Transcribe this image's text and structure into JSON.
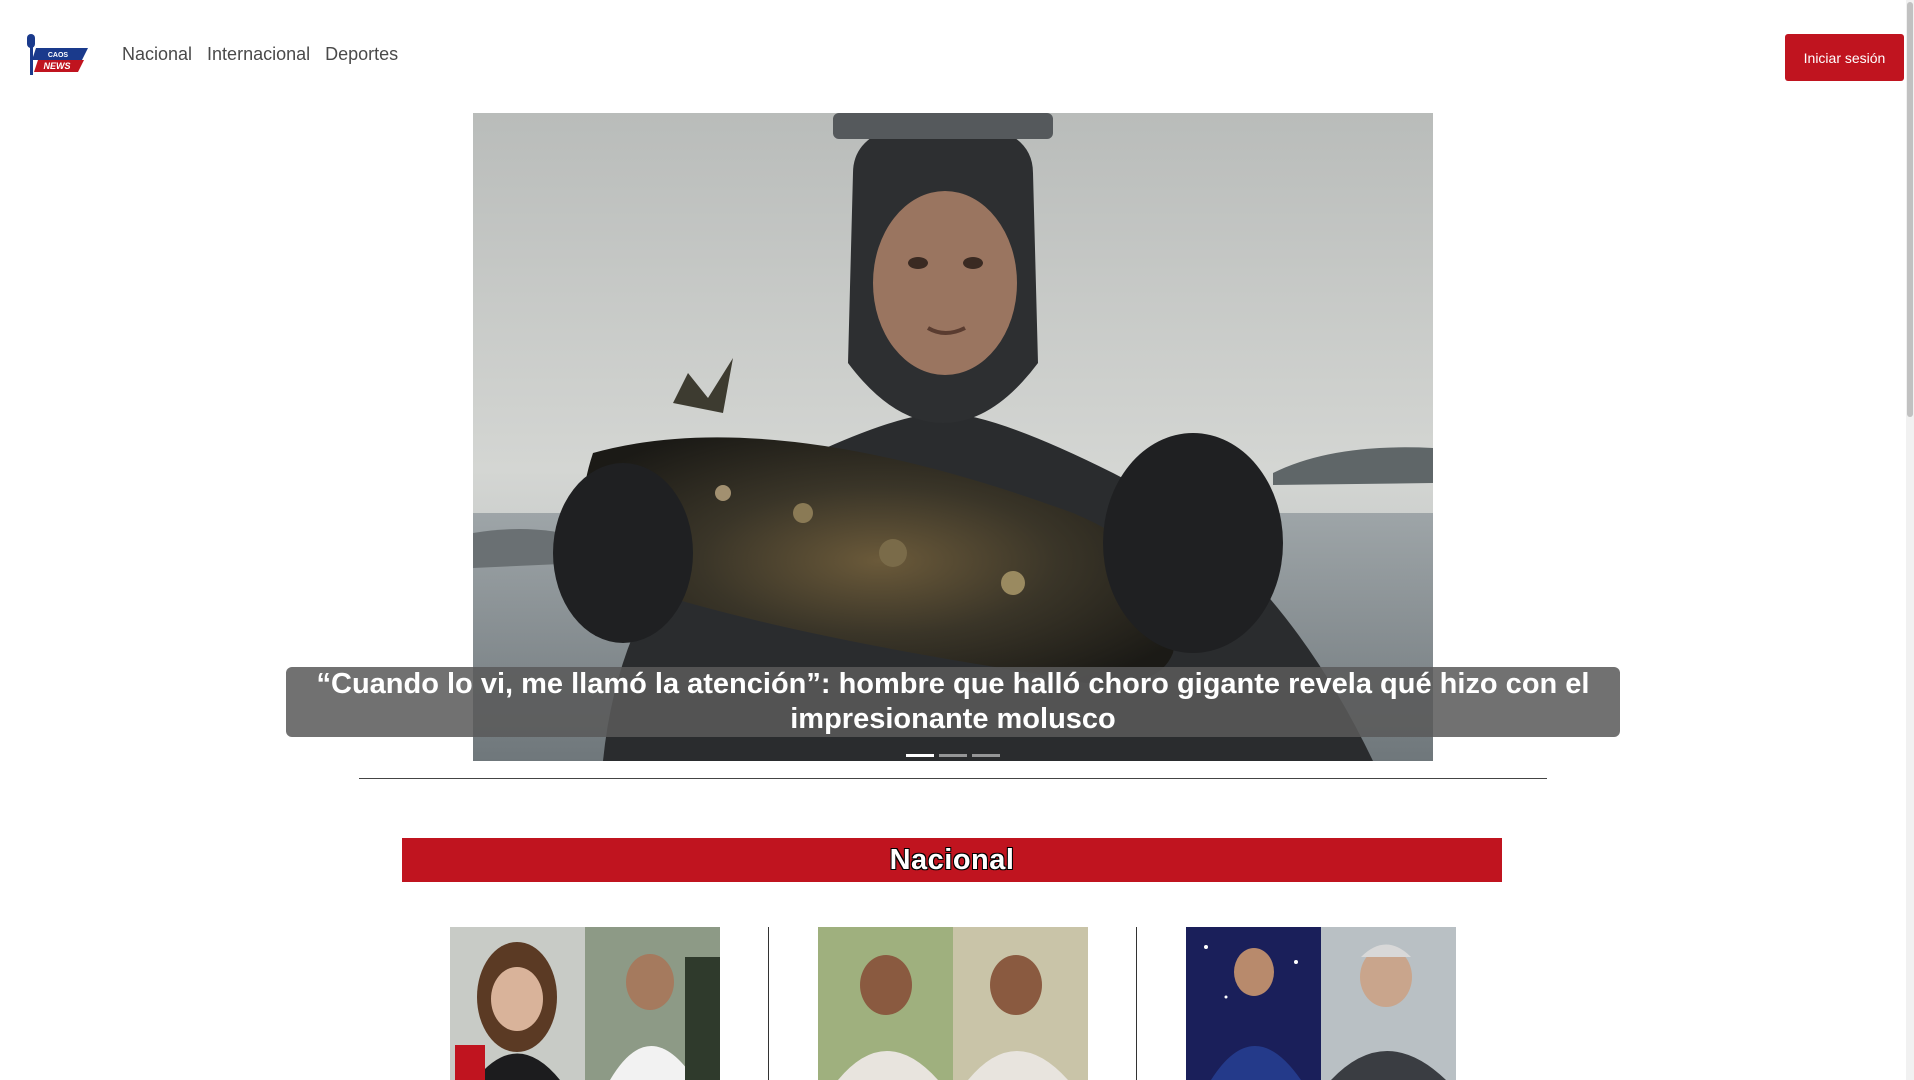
{
  "header": {
    "logo": {
      "text_top": "CAOS",
      "text_bottom": "NEWS",
      "brand_red": "#c0141f",
      "brand_blue": "#1a3a8c"
    },
    "nav": [
      {
        "label": "Nacional"
      },
      {
        "label": "Internacional"
      },
      {
        "label": "Deportes"
      }
    ],
    "login_label": "Iniciar sesión"
  },
  "hero": {
    "headline": "“Cuando lo vi, me llamó la atención”: hombre que halló choro gigante revela qué hizo con el impresionante molusco",
    "image_icon": "diver-holding-giant-mussel-photo",
    "slides_total": 3,
    "active_slide": 1
  },
  "section": {
    "title": "Nacional",
    "accent": "#c0141f"
  },
  "cards": [
    {
      "image_icon": "young-woman-interview-and-young-man-photo"
    },
    {
      "image_icon": "smiling-woman-two-shots-photo"
    },
    {
      "image_icon": "comedian-on-stage-and-man-with-microphone-photo"
    }
  ]
}
